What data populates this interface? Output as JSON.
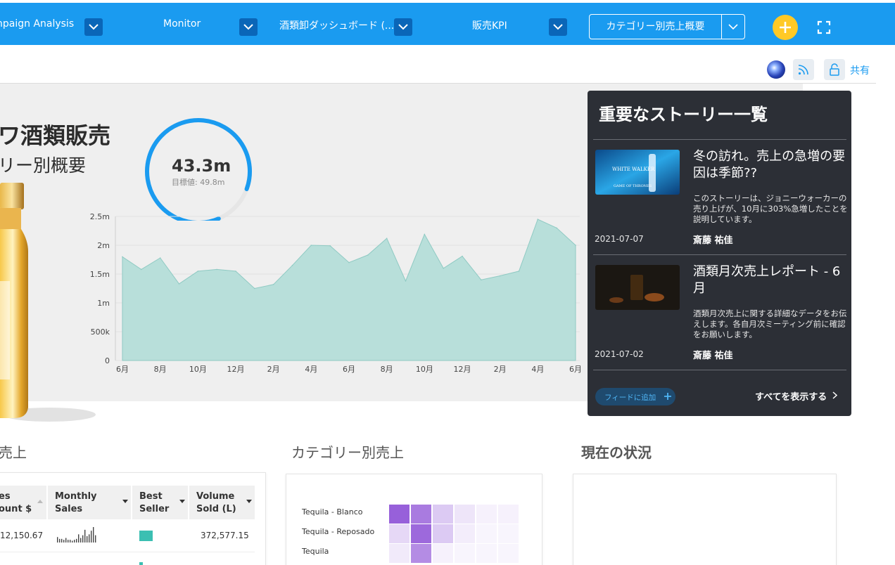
{
  "topbar": {
    "tabs": [
      {
        "label": "npaign Analysis"
      },
      {
        "label": "Monitor"
      },
      {
        "label": "酒類卸ダッシュボード (..."
      },
      {
        "label": "販売KPI"
      }
    ],
    "active_tab": "カテゴリー別売上概要"
  },
  "toolbar": {
    "share_label": "共有"
  },
  "hero": {
    "title": "ワ酒類販売",
    "subtitle": "リー別概要",
    "gauge": {
      "value": "43.3m",
      "target": "目標値: 49.8m",
      "fraction": 0.87
    }
  },
  "chart_data": {
    "type": "area",
    "x": [
      "6月",
      "7月",
      "8月",
      "9月",
      "10月",
      "11月",
      "12月",
      "1月",
      "2月",
      "3月",
      "4月",
      "5月",
      "6月",
      "7月",
      "8月",
      "9月",
      "10月",
      "11月",
      "12月",
      "1月",
      "2月",
      "3月",
      "4月",
      "5月",
      "6月"
    ],
    "x_ticks": [
      "6月",
      "8月",
      "10月",
      "12月",
      "2月",
      "4月",
      "6月",
      "8月",
      "10月",
      "12月",
      "2月",
      "4月",
      "6月"
    ],
    "values": [
      1800000,
      1580000,
      1780000,
      1330000,
      1550000,
      1580000,
      1550000,
      1250000,
      1320000,
      1650000,
      2000000,
      1990000,
      1700000,
      1830000,
      2120000,
      1380000,
      2190000,
      1600000,
      1810000,
      1400000,
      1470000,
      1550000,
      2450000,
      2300000,
      2000000
    ],
    "y_ticks": [
      "0",
      "500k",
      "1m",
      "1.5m",
      "2m",
      "2.5m"
    ],
    "ylim": [
      0,
      2500000
    ],
    "color": "#b8dfda",
    "line_color": "#8fcac3"
  },
  "stories": {
    "title": "重要なストーリー一覧",
    "items": [
      {
        "title": "冬の訪れ。売上の急増の要因は季節??",
        "description": "このストーリーは、ジョニーウォーカーの売り上げが、10月に303%急増したことを説明しています。",
        "date": "2021-07-07",
        "author": "斎藤 祐佳",
        "thumb_text_1": "WHITE WALKER",
        "thumb_text_2": "GAME OF THRONES"
      },
      {
        "title": "酒類月次売上レポート - 6月",
        "description": "酒類月次売上に関する詳細なデータをお伝えします。各自月次ミーティング前に確認をお願いします。",
        "date": "2021-07-02",
        "author": "斎藤 祐佳"
      }
    ],
    "add_feed": "フィードに追加",
    "show_all": "すべてを表示する"
  },
  "sections": {
    "sales": "売上",
    "category": "カテゴリー別売上",
    "status": "現在の状況"
  },
  "grid": {
    "headers": [
      {
        "line1": "es",
        "line2": "ount $"
      },
      {
        "line1": "Monthly",
        "line2": "Sales"
      },
      {
        "line1": "Best",
        "line2": "Seller"
      },
      {
        "line1": "Volume",
        "line2": "Sold (L)"
      }
    ],
    "row": {
      "amount": "12,150.67",
      "volume": "372,577.15"
    },
    "sparkline": [
      6,
      4,
      4,
      3,
      5,
      3,
      3,
      2,
      3,
      4,
      9,
      5,
      8,
      14,
      7,
      9,
      13,
      17,
      8
    ],
    "accent": "#3bbfb2"
  },
  "heatmap": {
    "labels": [
      "Tequila - Blanco",
      "Tequila - Reposado",
      "Tequila"
    ],
    "rows": [
      [
        0.9,
        0.75,
        0.3,
        0.15,
        0.08,
        0.08
      ],
      [
        0.22,
        0.85,
        0.3,
        0.1,
        0.06,
        0.06
      ],
      [
        0.12,
        0.65,
        0.08,
        0.06,
        0.05,
        0.05
      ]
    ],
    "color": "#8c4fd6"
  }
}
